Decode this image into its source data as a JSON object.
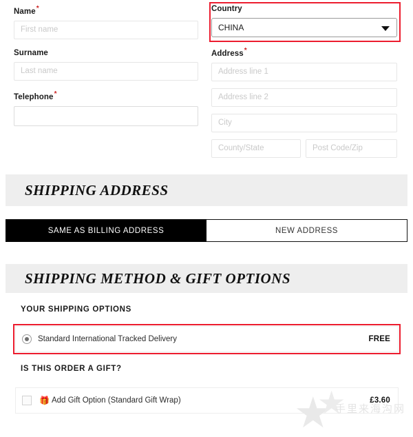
{
  "billing": {
    "name": {
      "label": "Name",
      "required_mark": "*",
      "placeholder": "First name",
      "value": ""
    },
    "surname": {
      "label": "Surname",
      "placeholder": "Last name",
      "value": ""
    },
    "telephone": {
      "label": "Telephone",
      "required_mark": "*",
      "placeholder": "",
      "value": ""
    },
    "country": {
      "label": "Country",
      "selected": "CHINA"
    },
    "address": {
      "label": "Address",
      "required_mark": "*",
      "line1_placeholder": "Address line 1",
      "line1_value": "",
      "line2_placeholder": "Address line 2",
      "line2_value": "",
      "city_placeholder": "City",
      "city_value": "",
      "county_placeholder": "County/State",
      "county_value": "",
      "postcode_placeholder": "Post Code/Zip",
      "postcode_value": ""
    }
  },
  "shipping_address": {
    "heading": "SHIPPING ADDRESS",
    "tabs": [
      {
        "label": "SAME AS BILLING ADDRESS",
        "active": true
      },
      {
        "label": "NEW ADDRESS",
        "active": false
      }
    ]
  },
  "shipping_method": {
    "heading": "SHIPPING METHOD & GIFT OPTIONS",
    "options_heading": "YOUR SHIPPING OPTIONS",
    "options": [
      {
        "label": "Standard International Tracked Delivery",
        "price": "FREE",
        "selected": true
      }
    ],
    "gift_heading": "IS THIS ORDER A GIFT?",
    "gift_options": [
      {
        "icon": "gift-icon",
        "label": "Add Gift Option (Standard Gift Wrap)",
        "price": "£3.60",
        "checked": false
      }
    ]
  },
  "annotations": {
    "highlight_color": "#ec1c2e",
    "boxes": [
      {
        "name": "country-select-highlight"
      },
      {
        "name": "shipping-option-highlight"
      }
    ]
  },
  "watermark": {
    "text": "手里来海沟网",
    "star_glyph": "★"
  }
}
